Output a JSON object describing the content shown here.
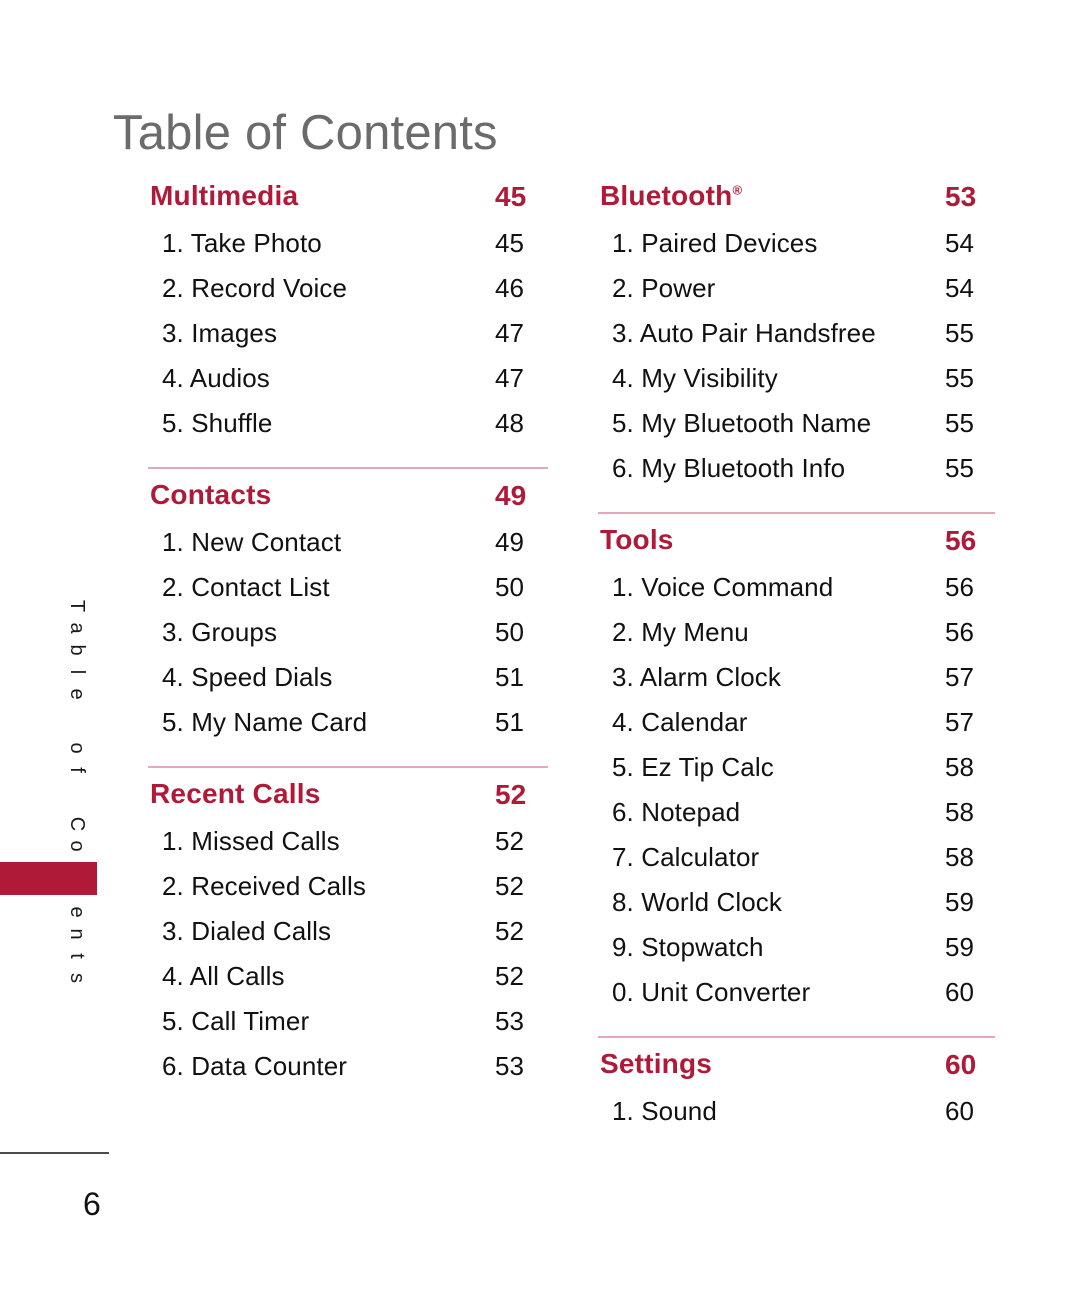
{
  "page": {
    "title": "Table of Contents",
    "number": "6",
    "side_tab_label": "Table of Contents",
    "accent_color": "#b01a39",
    "rule_color": "#e5a8b8",
    "title_color": "#6b6b6b"
  },
  "columns": [
    {
      "id": "left",
      "sections": [
        {
          "rule_above": false,
          "title": "Multimedia",
          "trademark": "",
          "page": "45",
          "entries": [
            {
              "label": "1. Take Photo",
              "page": "45"
            },
            {
              "label": "2. Record Voice",
              "page": "46"
            },
            {
              "label": "3. Images",
              "page": "47"
            },
            {
              "label": "4. Audios",
              "page": "47"
            },
            {
              "label": "5. Shuffle",
              "page": "48"
            }
          ]
        },
        {
          "rule_above": true,
          "title": "Contacts",
          "trademark": "",
          "page": "49",
          "entries": [
            {
              "label": "1. New Contact",
              "page": "49"
            },
            {
              "label": "2. Contact List",
              "page": "50"
            },
            {
              "label": "3. Groups",
              "page": "50"
            },
            {
              "label": "4. Speed Dials",
              "page": "51"
            },
            {
              "label": "5. My Name Card",
              "page": "51"
            }
          ]
        },
        {
          "rule_above": true,
          "title": "Recent Calls",
          "trademark": "",
          "page": "52",
          "entries": [
            {
              "label": "1. Missed Calls",
              "page": "52"
            },
            {
              "label": "2. Received Calls",
              "page": "52"
            },
            {
              "label": "3. Dialed Calls",
              "page": "52"
            },
            {
              "label": "4. All Calls",
              "page": "52"
            },
            {
              "label": "5. Call Timer",
              "page": "53"
            },
            {
              "label": "6. Data Counter",
              "page": "53"
            }
          ]
        }
      ]
    },
    {
      "id": "right",
      "sections": [
        {
          "rule_above": false,
          "title": "Bluetooth",
          "trademark": "®",
          "page": "53",
          "entries": [
            {
              "label": "1. Paired Devices",
              "page": "54"
            },
            {
              "label": "2. Power",
              "page": "54"
            },
            {
              "label": "3. Auto Pair Handsfree",
              "page": "55"
            },
            {
              "label": "4. My Visibility",
              "page": "55"
            },
            {
              "label": "5. My Bluetooth Name",
              "page": "55"
            },
            {
              "label": "6. My Bluetooth Info",
              "page": "55"
            }
          ]
        },
        {
          "rule_above": true,
          "title": "Tools",
          "trademark": "",
          "page": "56",
          "entries": [
            {
              "label": "1. Voice Command",
              "page": "56"
            },
            {
              "label": "2. My Menu",
              "page": "56"
            },
            {
              "label": "3. Alarm Clock",
              "page": "57"
            },
            {
              "label": "4. Calendar",
              "page": "57"
            },
            {
              "label": "5. Ez Tip Calc",
              "page": "58"
            },
            {
              "label": "6. Notepad",
              "page": "58"
            },
            {
              "label": "7. Calculator",
              "page": "58"
            },
            {
              "label": "8. World Clock",
              "page": "59"
            },
            {
              "label": "9. Stopwatch",
              "page": "59"
            },
            {
              "label": "0. Unit Converter",
              "page": "60"
            }
          ]
        },
        {
          "rule_above": true,
          "title": "Settings",
          "trademark": "",
          "page": "60",
          "entries": [
            {
              "label": "1. Sound",
              "page": "60"
            }
          ]
        }
      ]
    }
  ]
}
